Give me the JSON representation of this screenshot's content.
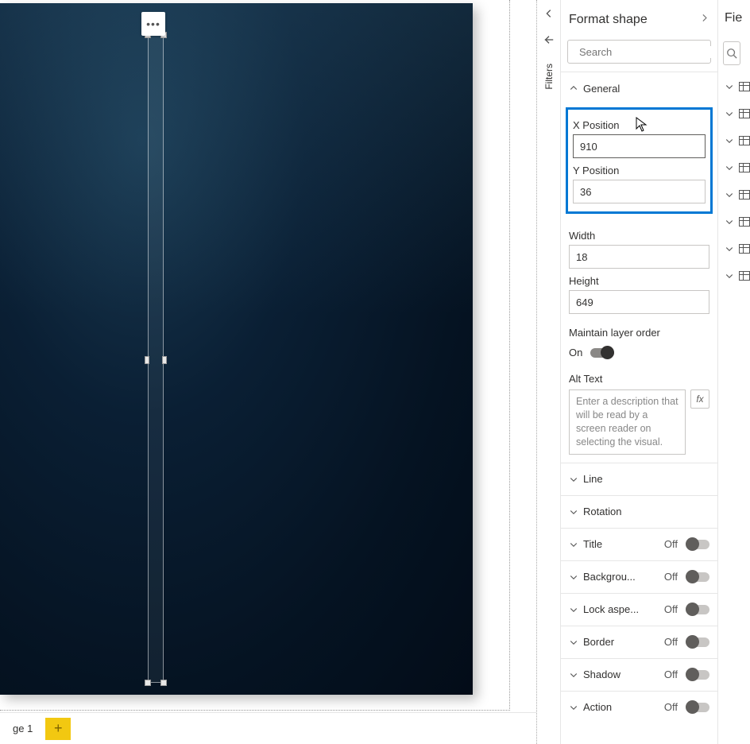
{
  "page_tab": "ge 1",
  "rail": {
    "filters_label": "Filters"
  },
  "format_pane": {
    "title": "Format shape",
    "search_placeholder": "Search",
    "sections": {
      "general": {
        "label": "General",
        "x_label": "X Position",
        "x_value": "910",
        "y_label": "Y Position",
        "y_value": "36",
        "w_label": "Width",
        "w_value": "18",
        "h_label": "Height",
        "h_value": "649",
        "maintain_label": "Maintain layer order",
        "maintain_state": "On",
        "alt_label": "Alt Text",
        "alt_placeholder": "Enter a description that will be read by a screen reader on selecting the visual.",
        "fx_label": "fx"
      },
      "line": {
        "label": "Line"
      },
      "rotation": {
        "label": "Rotation"
      },
      "title": {
        "label": "Title",
        "state": "Off"
      },
      "background": {
        "label": "Backgrou...",
        "state": "Off"
      },
      "lock": {
        "label": "Lock aspe...",
        "state": "Off"
      },
      "border": {
        "label": "Border",
        "state": "Off"
      },
      "shadow": {
        "label": "Shadow",
        "state": "Off"
      },
      "action": {
        "label": "Action",
        "state": "Off"
      }
    }
  },
  "fields_pane": {
    "title": "Fie"
  }
}
